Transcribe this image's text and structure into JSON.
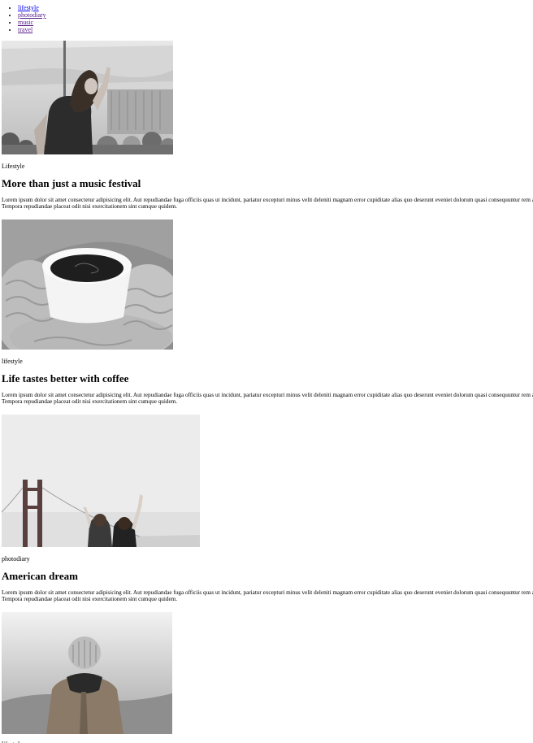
{
  "nav": {
    "items": [
      {
        "label": "lifestyle"
      },
      {
        "label": "photodiary"
      },
      {
        "label": "music"
      },
      {
        "label": "travel"
      }
    ]
  },
  "posts": [
    {
      "category": "Lifestyle",
      "title": "More than just a music festival",
      "excerpt": "Lorem ipsum dolor sit amet consectetur adipisicing elit. Aut repudiandae fuga officiis quas ut incidunt, pariatur excepturi minus velit deleniti magnam error cupiditate alias quo deserunt eveniet dolorum quasi consequuntur rem aliquam? Tempora repudiandae placeat odit nisi exercitationem sint cumque quidem."
    },
    {
      "category": "lifestyle",
      "title": "Life tastes better with coffee",
      "excerpt": "Lorem ipsum dolor sit amet consectetur adipisicing elit. Aut repudiandae fuga officiis quas ut incidunt, pariatur excepturi minus velit deleniti magnam error cupiditate alias quo deserunt eveniet dolorum quasi consequuntur rem aliquam? Tempora repudiandae placeat odit nisi exercitationem sint cumque quidem."
    },
    {
      "category": "photodiary",
      "title": "American dream",
      "excerpt": "Lorem ipsum dolor sit amet consectetur adipisicing elit. Aut repudiandae fuga officiis quas ut incidunt, pariatur excepturi minus velit deleniti magnam error cupiditate alias quo deserunt eveniet dolorum quasi consequuntur rem aliquam? Tempora repudiandae placeat odit nisi exercitationem sint cumque quidem."
    },
    {
      "category": "lifestyle"
    }
  ]
}
